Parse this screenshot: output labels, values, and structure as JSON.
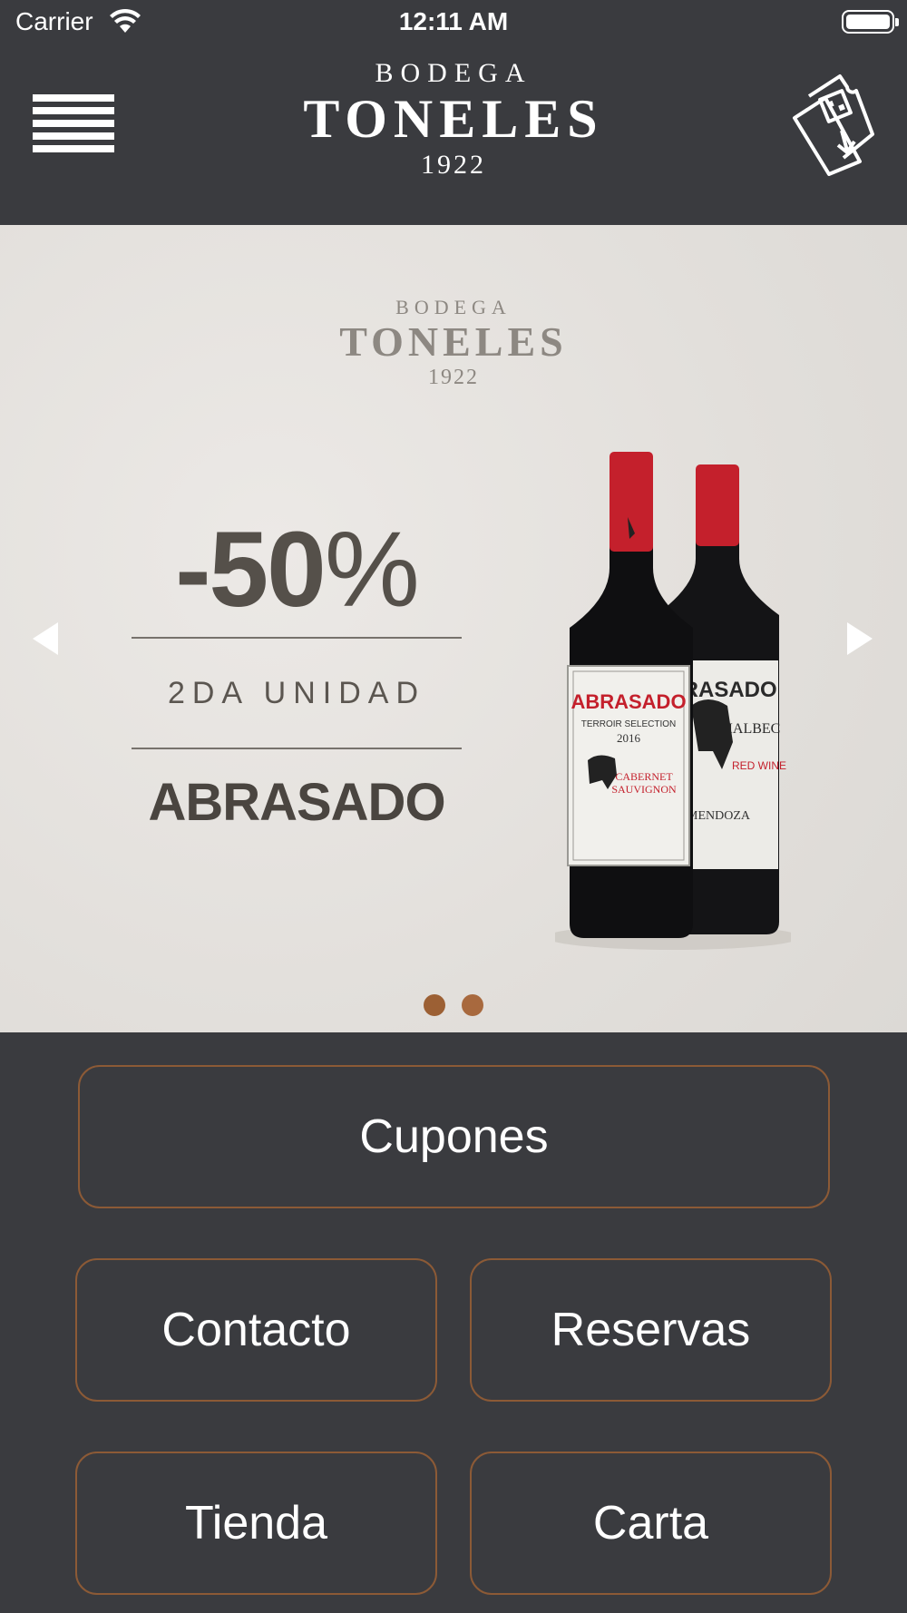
{
  "status_bar": {
    "carrier": "Carrier",
    "time": "12:11 AM"
  },
  "header": {
    "logo": {
      "line1": "BODEGA",
      "line2": "TONELES",
      "line3": "1922"
    },
    "menu_icon": "hamburger-menu-icon",
    "ticket_icon": "ticket-download-icon"
  },
  "banner": {
    "logo": {
      "line1": "BODEGA",
      "line2": "TONELES",
      "line3": "1922"
    },
    "discount_value": "-50",
    "discount_symbol": "%",
    "subtitle": "2DA UNIDAD",
    "product": "ABRASADO",
    "slides": 2,
    "active_slide": 1
  },
  "buttons": {
    "cupones": "Cupones",
    "contacto": "Contacto",
    "reservas": "Reservas",
    "tienda": "Tienda",
    "carta": "Carta"
  },
  "colors": {
    "background": "#3a3b3f",
    "button_border": "#8c5a36",
    "dot": "#9c6034",
    "banner_bg": "#e6e3e0"
  }
}
